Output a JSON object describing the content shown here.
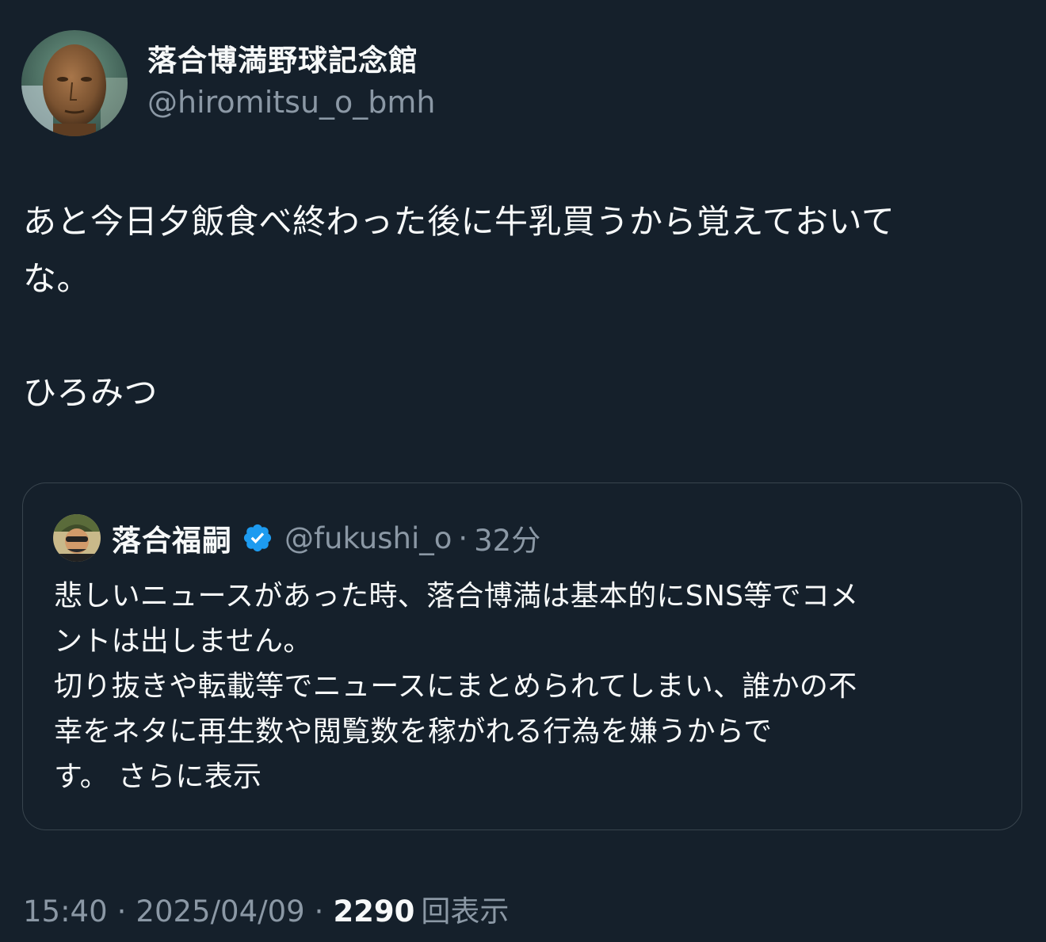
{
  "tweet": {
    "author_name": "落合博満野球記念館",
    "author_handle": "@hiromitsu_o_bmh",
    "text": "あと今日夕飯食べ終わった後に牛乳買うから覚えておいて\nな。\n\nひろみつ",
    "timestamp": "15:40",
    "date": "2025/04/09",
    "separator": "·",
    "views_count": "2290",
    "views_label": "回表示"
  },
  "quote": {
    "author_name": "落合福嗣",
    "author_handle": "@fukushi_o",
    "separator": "·",
    "time_ago": "32分",
    "text": "悲しいニュースがあった時、落合博満は基本的にSNS等でコメ\nントは出しません。\n切り抜きや転載等でニュースにまとめられてしまい、誰かの不\n幸をネタに再生数や閲覧数を稼がれる行為を嫌うからで\nす。 ",
    "show_more": "さらに表示",
    "verified_color": "#1d9bf0"
  },
  "icons": {
    "verified": "verified-badge-icon"
  },
  "colors": {
    "background": "#15202b",
    "text_primary": "#f7f9f9",
    "text_secondary": "#8b98a5",
    "border": "#38444d"
  }
}
